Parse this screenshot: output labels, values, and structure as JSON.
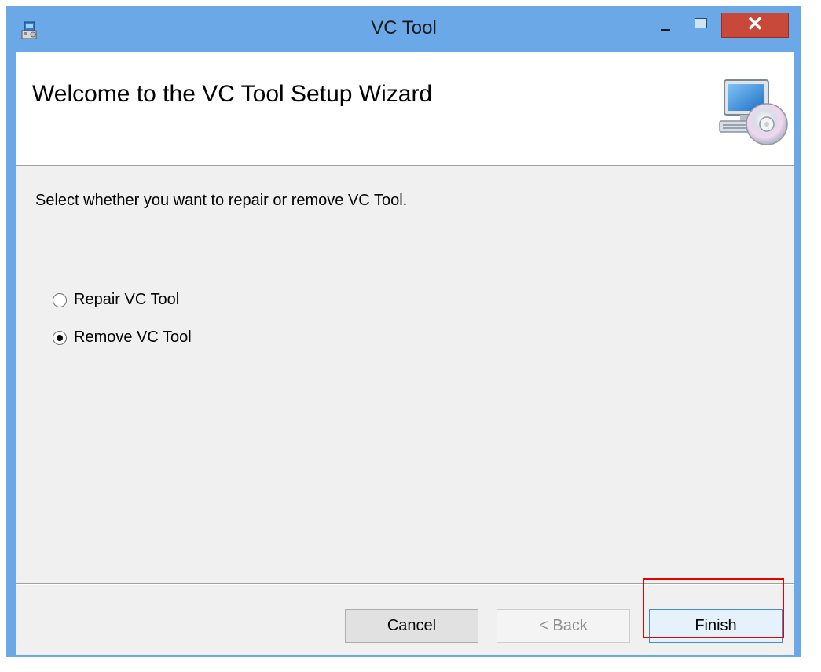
{
  "window": {
    "title": "VC Tool",
    "close_symbol": "✕",
    "icons": {
      "app": "installer-icon",
      "minimize": "minimize-icon",
      "maximize": "maximize-icon",
      "close": "close-icon"
    }
  },
  "header": {
    "title": "Welcome to the VC Tool Setup Wizard",
    "graphic": "computer-cd-icon"
  },
  "body": {
    "instruction": "Select whether you want to repair or remove VC Tool.",
    "options": [
      {
        "label": "Repair VC Tool",
        "selected": false
      },
      {
        "label": "Remove VC Tool",
        "selected": true
      }
    ]
  },
  "buttons": {
    "cancel": "Cancel",
    "back": "< Back",
    "finish": "Finish"
  },
  "colors": {
    "titlebar": "#6aa8e8",
    "close_button": "#c8483a",
    "highlight": "#e60000"
  }
}
